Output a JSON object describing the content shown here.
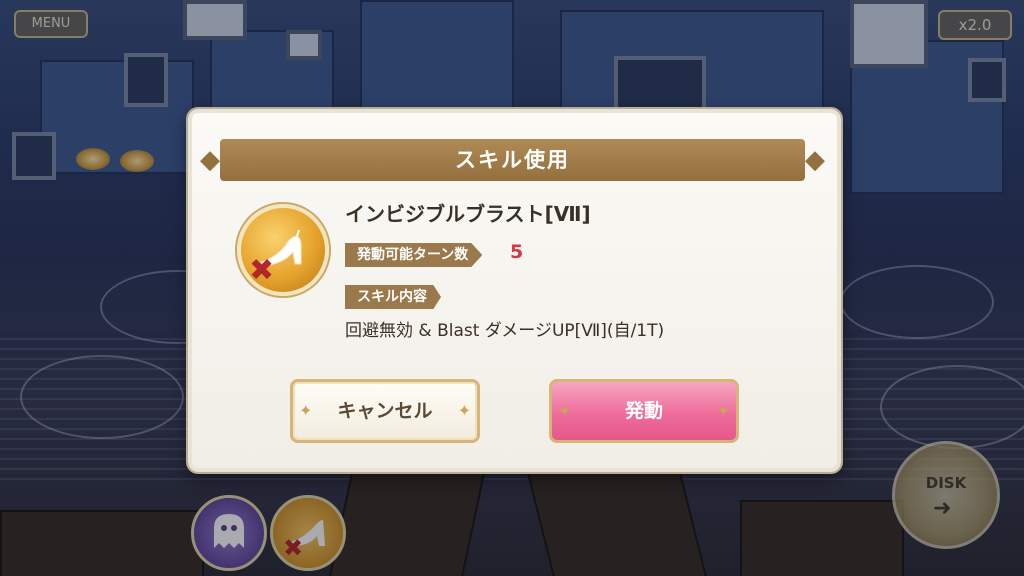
{
  "hud": {
    "menu_label": "MENU",
    "speed_label": "x2.0",
    "disk_label": "DISK"
  },
  "dialog": {
    "title": "スキル使用",
    "skill_name": "インビジブルブラスト[Ⅶ]",
    "turn_label": "発動可能ターン数",
    "turn_value": "5",
    "desc_label": "スキル内容",
    "description": "回避無効 & Blast ダメージUP[Ⅶ](自/1T)",
    "cancel_label": "キャンセル",
    "activate_label": "発動"
  },
  "icons": {
    "skill_icon": "glass-slipper-icon",
    "disabled_mark": "x-mark-icon",
    "ghost_skill": "ghost-icon",
    "disk_arrow": "arrow-right-icon"
  },
  "colors": {
    "banner": "#93703f",
    "accent_red": "#d6364a",
    "activate_pink": "#ee6d9a"
  }
}
